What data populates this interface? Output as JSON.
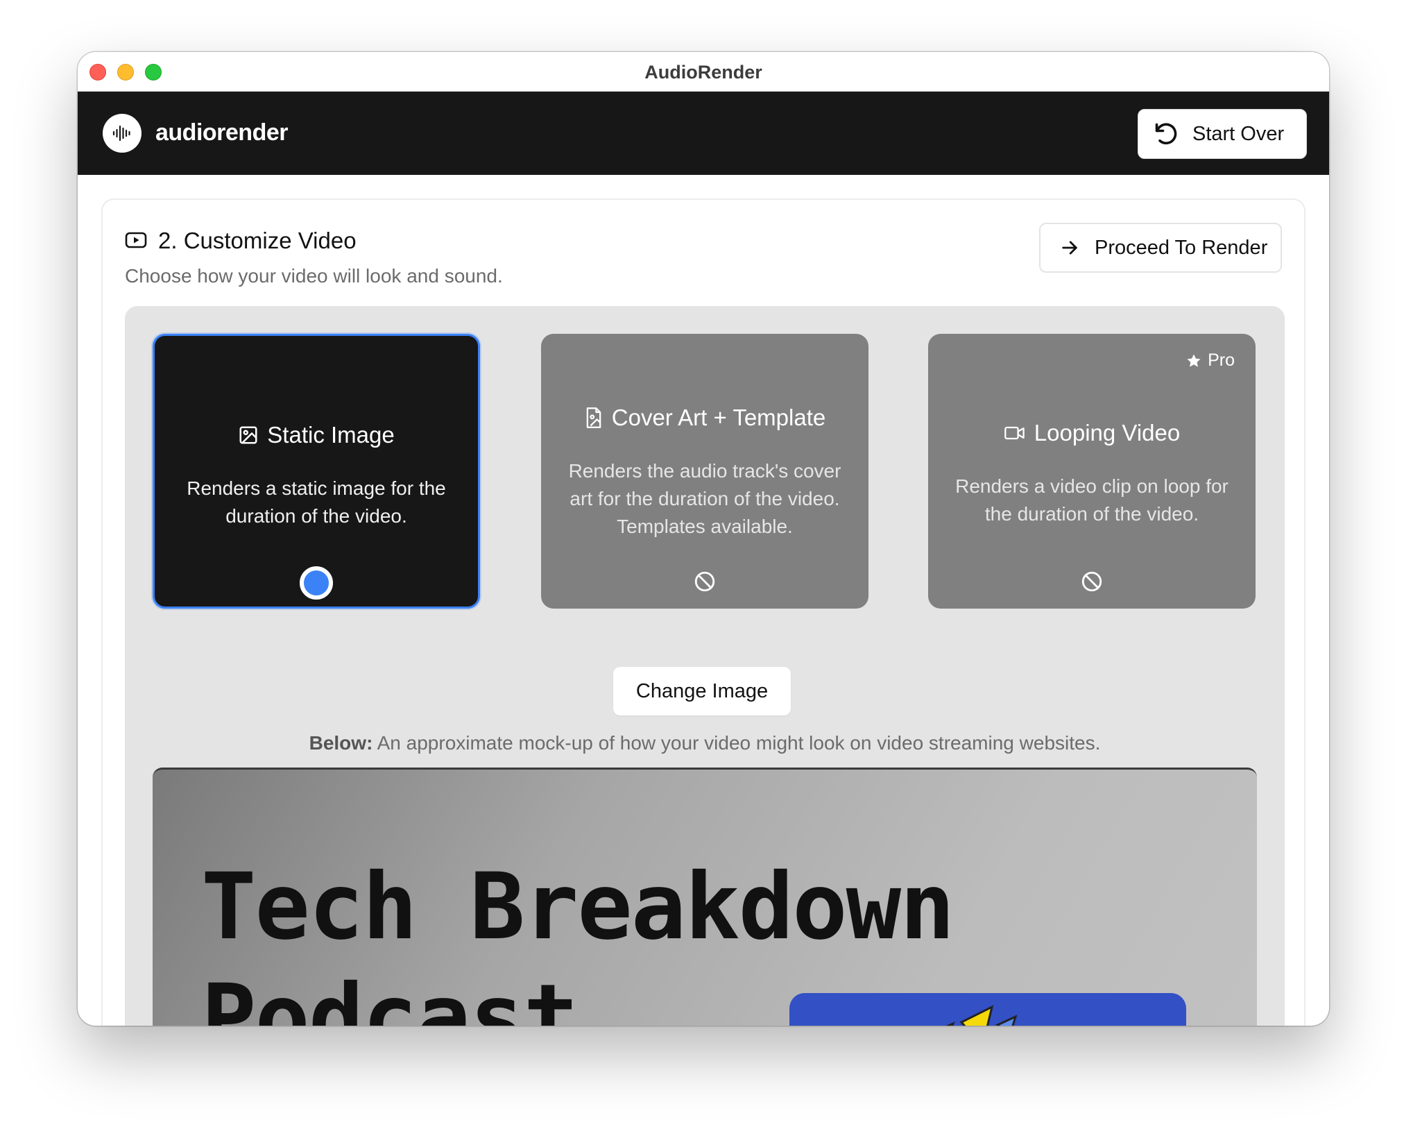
{
  "window": {
    "title": "AudioRender"
  },
  "appbar": {
    "brand": "audiorender",
    "start_over_label": "Start Over"
  },
  "customize": {
    "title": "2. Customize Video",
    "subtitle": "Choose how your video will look and sound.",
    "proceed_label": "Proceed To Render"
  },
  "options": [
    {
      "title": "Static Image",
      "description": "Renders a static image for the duration of the video.",
      "state": "selected"
    },
    {
      "title": "Cover Art + Template",
      "description": "Renders the audio track's cover art for the duration of the video. Templates available.",
      "state": "disabled"
    },
    {
      "title": "Looping Video",
      "description": "Renders a video clip on loop for the duration of the video.",
      "state": "disabled",
      "badge": "Pro"
    }
  ],
  "change_image_label": "Change Image",
  "preview_note": {
    "bold": "Below:",
    "text": " An approximate mock-up of how your video might look on video streaming websites."
  },
  "preview": {
    "title": "Tech Breakdown Podcast"
  },
  "colors": {
    "accent": "#3b82f6",
    "appbar": "#171717",
    "preview_art": "#3350c4"
  }
}
